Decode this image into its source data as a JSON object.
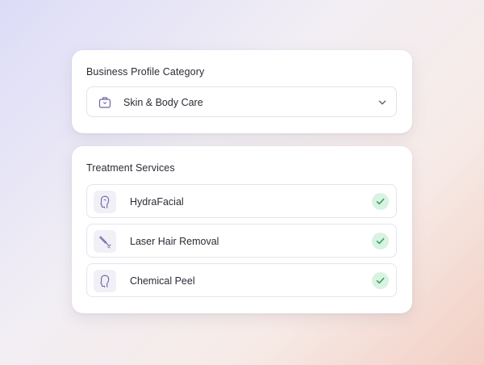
{
  "business_profile": {
    "title": "Business Profile Category",
    "selected_category": "Skin & Body Care",
    "category_icon": "briefcase-icon"
  },
  "treatment_services": {
    "title": "Treatment Services",
    "items": [
      {
        "label": "HydraFacial",
        "icon": "face-profile-icon",
        "selected": true
      },
      {
        "label": "Laser Hair Removal",
        "icon": "laser-wand-icon",
        "selected": true
      },
      {
        "label": "Chemical Peel",
        "icon": "face-profile-icon",
        "selected": true
      }
    ]
  },
  "colors": {
    "accent": "#6b63a8",
    "check_bg": "#d9f2e2",
    "check_fg": "#2f9e5b"
  }
}
